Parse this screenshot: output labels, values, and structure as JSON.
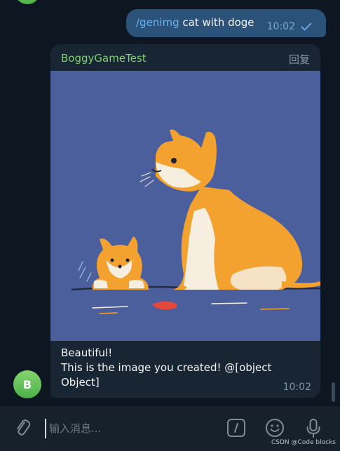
{
  "outgoing": {
    "command": "/genimg",
    "text": " cat with doge",
    "time": "10:02"
  },
  "incoming": {
    "sender": "BoggyGameTest",
    "reply_label": "回复",
    "image_alt": "cat with doge",
    "caption_line1": "Beautiful!",
    "caption_line2": "This is the image you created! @[object Object]",
    "time": "10:02"
  },
  "bot_avatar_letter": "B",
  "composer": {
    "placeholder": "输入消息..."
  },
  "watermark": "CSDN @Code blocks",
  "colors": {
    "background": "#0e1621",
    "outgoing_bubble": "#2b5278",
    "incoming_bubble": "#182533",
    "sender_name": "#7ed36e",
    "link": "#6ab3f3"
  }
}
